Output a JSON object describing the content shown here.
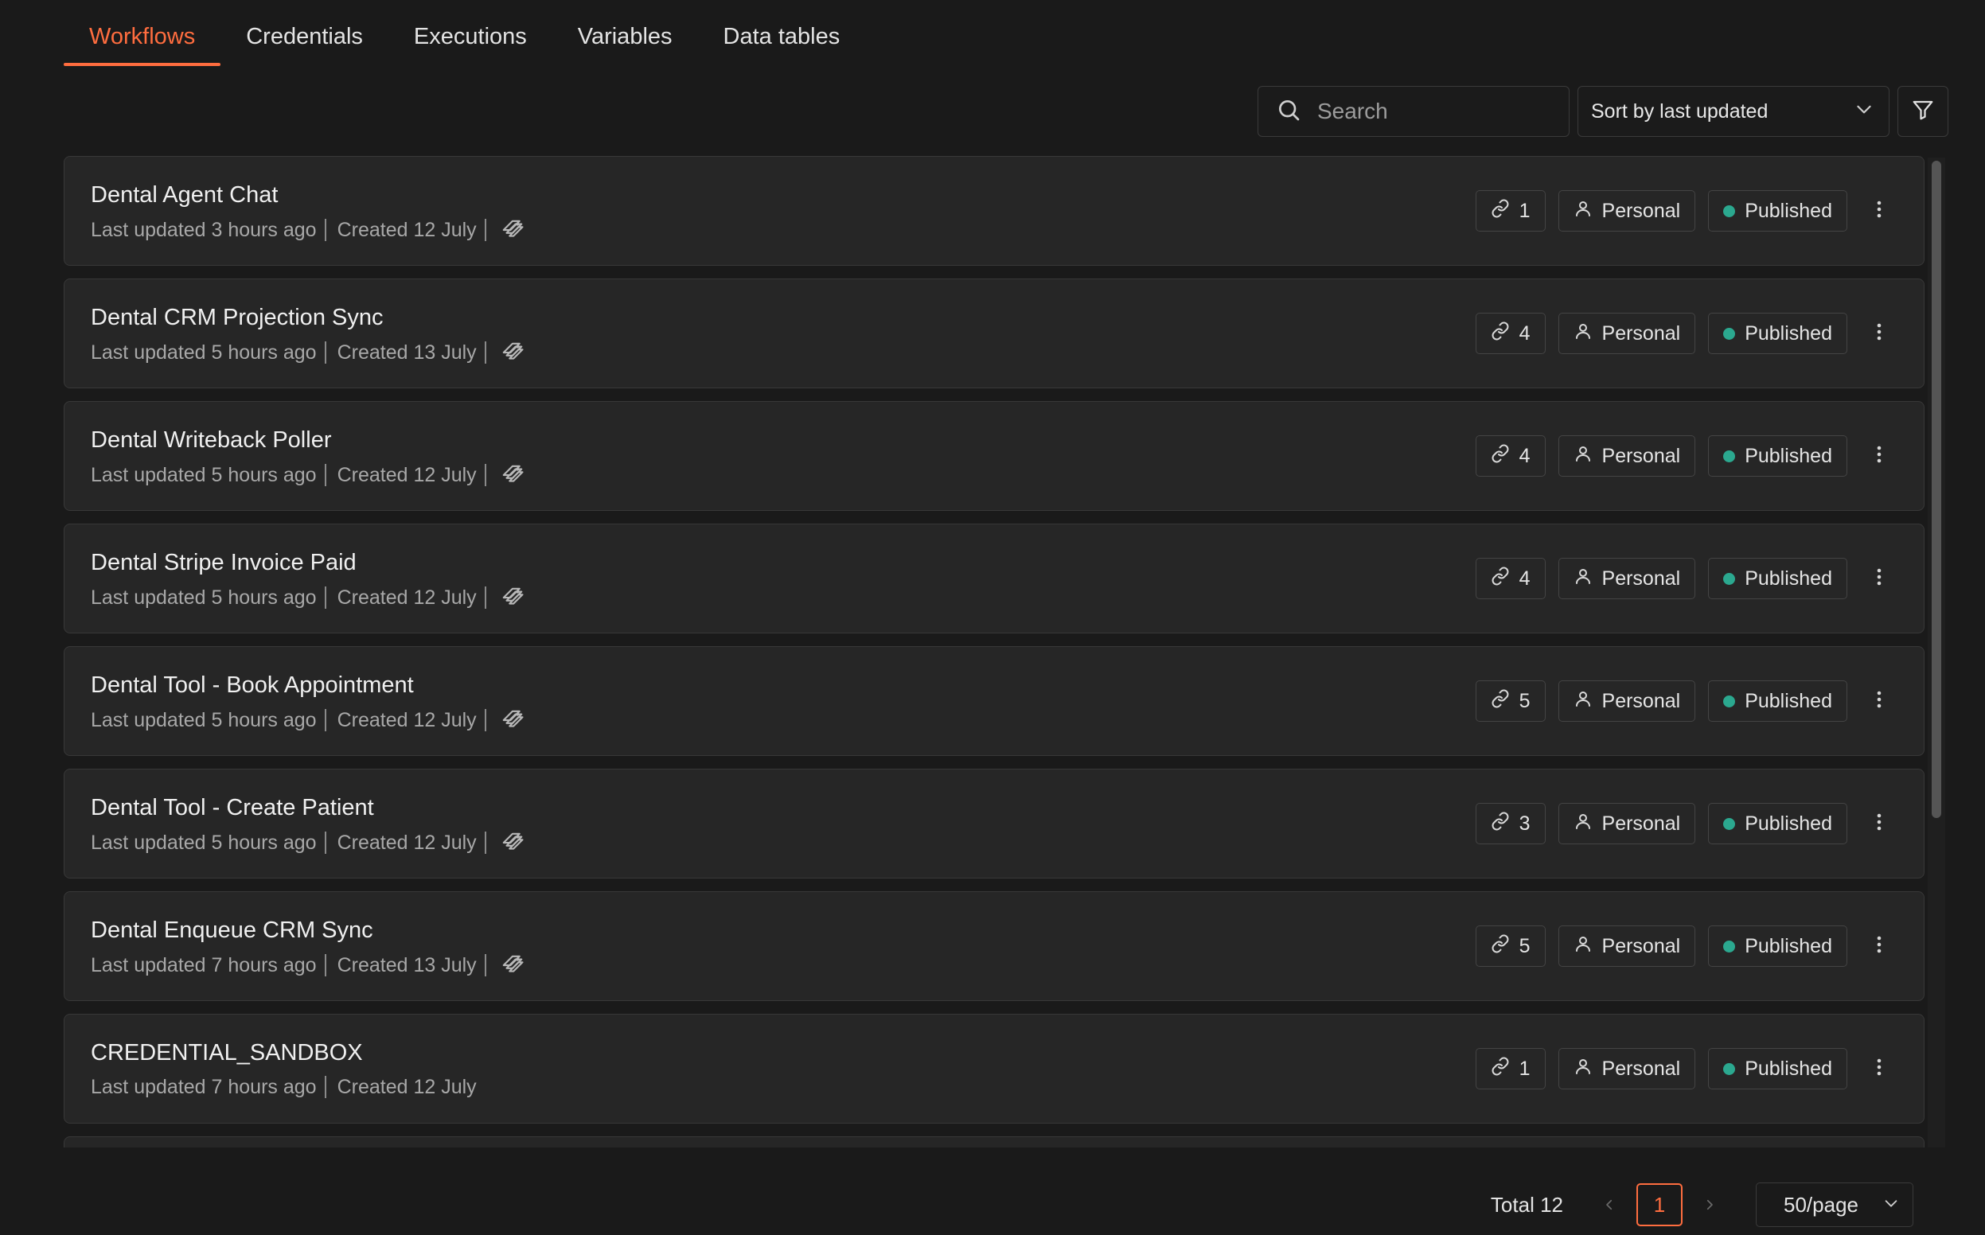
{
  "tabs": [
    {
      "label": "Workflows",
      "active": true
    },
    {
      "label": "Credentials",
      "active": false
    },
    {
      "label": "Executions",
      "active": false
    },
    {
      "label": "Variables",
      "active": false
    },
    {
      "label": "Data tables",
      "active": false
    }
  ],
  "toolbar": {
    "search_placeholder": "Search",
    "sort_label": "Sort by last updated"
  },
  "colors": {
    "accent": "#ff6d3f",
    "published_dot": "#2ba88f",
    "background": "#1a1a1a",
    "card": "#262626"
  },
  "workflows": [
    {
      "name": "Dental Agent Chat",
      "updated": "Last updated 3 hours ago",
      "created": "Created 12 July",
      "has_tag_icon": true,
      "links": "1",
      "owner": "Personal",
      "status": "Published"
    },
    {
      "name": "Dental CRM Projection Sync",
      "updated": "Last updated 5 hours ago",
      "created": "Created 13 July",
      "has_tag_icon": true,
      "links": "4",
      "owner": "Personal",
      "status": "Published"
    },
    {
      "name": "Dental Writeback Poller",
      "updated": "Last updated 5 hours ago",
      "created": "Created 12 July",
      "has_tag_icon": true,
      "links": "4",
      "owner": "Personal",
      "status": "Published"
    },
    {
      "name": "Dental Stripe Invoice Paid",
      "updated": "Last updated 5 hours ago",
      "created": "Created 12 July",
      "has_tag_icon": true,
      "links": "4",
      "owner": "Personal",
      "status": "Published"
    },
    {
      "name": "Dental Tool - Book Appointment",
      "updated": "Last updated 5 hours ago",
      "created": "Created 12 July",
      "has_tag_icon": true,
      "links": "5",
      "owner": "Personal",
      "status": "Published"
    },
    {
      "name": "Dental Tool - Create Patient",
      "updated": "Last updated 5 hours ago",
      "created": "Created 12 July",
      "has_tag_icon": true,
      "links": "3",
      "owner": "Personal",
      "status": "Published"
    },
    {
      "name": "Dental Enqueue CRM Sync",
      "updated": "Last updated 7 hours ago",
      "created": "Created 13 July",
      "has_tag_icon": true,
      "links": "5",
      "owner": "Personal",
      "status": "Published"
    },
    {
      "name": "CREDENTIAL_SANDBOX",
      "updated": "Last updated 7 hours ago",
      "created": "Created 12 July",
      "has_tag_icon": false,
      "links": "1",
      "owner": "Personal",
      "status": "Published"
    }
  ],
  "pagination": {
    "total": "Total 12",
    "current_page": "1",
    "per_page": "50/page"
  }
}
